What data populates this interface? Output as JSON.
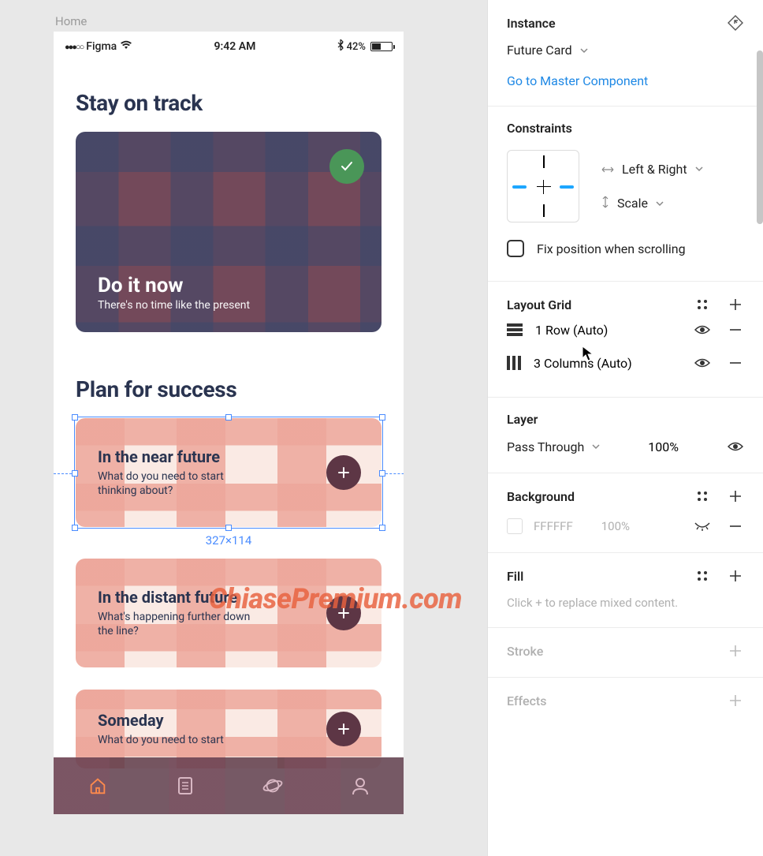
{
  "canvas": {
    "frame_label": "Home",
    "status": {
      "carrier": "Figma",
      "time": "9:42 AM",
      "battery_pct": "42%"
    },
    "section1_title": "Stay on track",
    "now_card": {
      "title": "Do it now",
      "subtitle": "There's no time like the present"
    },
    "section2_title": "Plan for success",
    "future_cards": [
      {
        "title": "In the near future",
        "subtitle": "What do you need to start thinking about?"
      },
      {
        "title": "In the distant future",
        "subtitle": "What's happening further down the line?"
      },
      {
        "title": "Someday",
        "subtitle": "What do you need to start"
      }
    ],
    "selection_dim": "327×114"
  },
  "panel": {
    "instance": {
      "heading": "Instance",
      "component_name": "Future Card",
      "master_link": "Go to Master Component"
    },
    "constraints": {
      "heading": "Constraints",
      "horizontal": "Left & Right",
      "vertical": "Scale",
      "fix_label": "Fix position when scrolling"
    },
    "layout_grid": {
      "heading": "Layout Grid",
      "rows": [
        {
          "label": "1 Row (Auto)"
        },
        {
          "label": "3 Columns (Auto)"
        }
      ]
    },
    "layer": {
      "heading": "Layer",
      "blend": "Pass Through",
      "opacity": "100%"
    },
    "background": {
      "heading": "Background",
      "color": "FFFFFF",
      "opacity": "100%"
    },
    "fill": {
      "heading": "Fill",
      "hint": "Click + to replace mixed content."
    },
    "stroke": {
      "heading": "Stroke"
    },
    "effects": {
      "heading": "Effects"
    }
  },
  "watermark": "ChiasePremium.com"
}
